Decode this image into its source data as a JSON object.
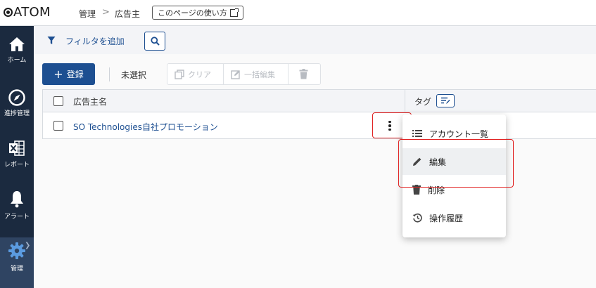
{
  "header": {
    "logo_text": "ATOM",
    "breadcrumb": [
      "管理",
      "広告主"
    ],
    "breadcrumb_separator": ">",
    "howto_label": "このページの使い方"
  },
  "sidebar": {
    "items": [
      {
        "label": "ホーム",
        "icon": "home-icon"
      },
      {
        "label": "進捗管理",
        "icon": "compass-icon"
      },
      {
        "label": "レポート",
        "icon": "excel-icon"
      },
      {
        "label": "アラート",
        "icon": "bell-icon"
      },
      {
        "label": "管理",
        "icon": "gear-icon",
        "active": true
      }
    ]
  },
  "filter": {
    "add_filter_label": "フィルタを追加"
  },
  "toolbar": {
    "add_label": "登録",
    "selection_status": "未選択",
    "clear_label": "クリア",
    "bulk_edit_label": "一括編集"
  },
  "table": {
    "columns": [
      "広告主名",
      "タグ"
    ],
    "rows": [
      {
        "name": "SO Technologies自社プロモーション"
      }
    ]
  },
  "context_menu": {
    "items": [
      {
        "label": "アカウント一覧",
        "icon": "list-icon"
      },
      {
        "label": "編集",
        "icon": "pencil-icon"
      },
      {
        "label": "削除",
        "icon": "trash-icon"
      },
      {
        "label": "操作履歴",
        "icon": "history-icon"
      }
    ]
  },
  "colors": {
    "primary": "#1d4f91",
    "sidebar_bg": "#1b2a3f",
    "sidebar_active": "#2f4462",
    "highlight_red": "#e02020"
  }
}
